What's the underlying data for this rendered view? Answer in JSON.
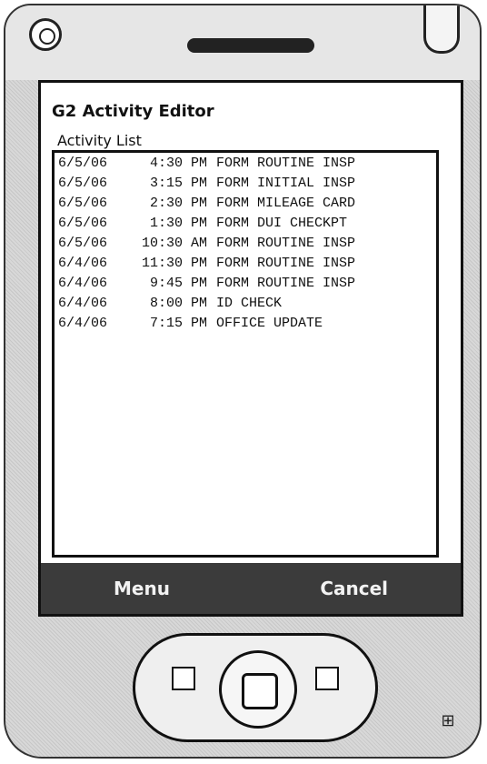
{
  "window": {
    "title": "G2 Activity Editor",
    "section_title": "Activity List"
  },
  "activities": [
    {
      "date": "6/5/06",
      "time": "4:30 PM",
      "desc": "FORM ROUTINE INSP"
    },
    {
      "date": "6/5/06",
      "time": "3:15 PM",
      "desc": "FORM INITIAL INSP"
    },
    {
      "date": "6/5/06",
      "time": "2:30 PM",
      "desc": "FORM MILEAGE CARD"
    },
    {
      "date": "6/5/06",
      "time": "1:30 PM",
      "desc": "FORM DUI CHECKPT"
    },
    {
      "date": "6/5/06",
      "time": "10:30 AM",
      "desc": "FORM ROUTINE INSP"
    },
    {
      "date": "6/4/06",
      "time": "11:30 PM",
      "desc": "FORM ROUTINE INSP"
    },
    {
      "date": "6/4/06",
      "time": "9:45 PM",
      "desc": "FORM ROUTINE INSP"
    },
    {
      "date": "6/4/06",
      "time": "8:00 PM",
      "desc": "ID CHECK"
    },
    {
      "date": "6/4/06",
      "time": "7:15 PM",
      "desc": "OFFICE UPDATE"
    }
  ],
  "menu": {
    "left": "Menu",
    "right": "Cancel"
  },
  "icons": {
    "power": "power-icon",
    "speaker": "speaker-grille",
    "stylus": "stylus-slot",
    "dpad": "dpad-control",
    "windows": "windows-logo-icon"
  }
}
